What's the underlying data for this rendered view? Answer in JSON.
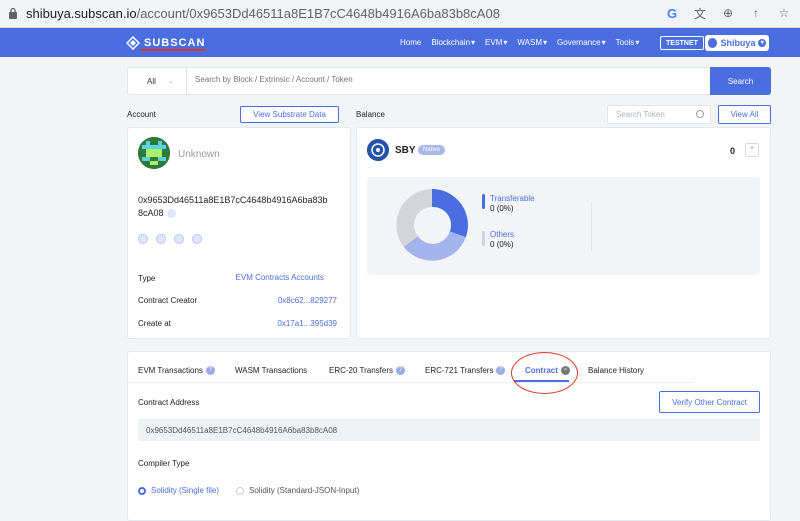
{
  "browser": {
    "url_host": "shibuya.subscan.io",
    "url_path": "/account/0x9653Dd46511a8E1B7cC4648b4916A6ba83b8cA08"
  },
  "nav": {
    "logo": "SUBSCAN",
    "links": [
      "Home",
      "Blockchain",
      "EVM",
      "WASM",
      "Governance",
      "Tools"
    ],
    "testnet": "TESTNET",
    "network": "Shibuya"
  },
  "search": {
    "select": "All",
    "placeholder": "Search by Block / Extrinsic / Account / Token",
    "button": "Search"
  },
  "account": {
    "heading": "Account",
    "view_substrate": "View Substrate Data",
    "name": "Unknown",
    "address": "0x9653Dd46511a8E1B7cC4648b4916A6ba83b8cA08",
    "rows": [
      {
        "key": "Type",
        "value": "EVM Contracts Accounts"
      },
      {
        "key": "Contract Creator",
        "value": "0x8c62...829277"
      },
      {
        "key": "Create at",
        "value": "0x17a1...395d39"
      }
    ]
  },
  "balance": {
    "heading": "Balance",
    "search_token_placeholder": "Search Token",
    "view_all": "View All",
    "token": "SBY",
    "badge": "Native",
    "total": "0",
    "legend": [
      {
        "label": "Transferable",
        "value": "0",
        "pct": "(0%)",
        "color": "#4a6ee0"
      },
      {
        "label": "Others",
        "value": "0",
        "pct": "(0%)",
        "color": "#cfd3dc"
      }
    ],
    "donut_colors": [
      "#4a6ee0",
      "#a3b3ec",
      "#d3d5da"
    ]
  },
  "tabs": {
    "items": [
      "EVM Transactions",
      "WASM Transactions",
      "ERC-20 Transfers",
      "ERC-721 Transfers",
      "Contract",
      "Balance History"
    ],
    "active": "Contract"
  },
  "contract": {
    "address_label": "Contract Address",
    "verify_button": "Verify Other Contract",
    "address": "0x9653Dd46511a8E1B7cC4648b4916A6ba83b8cA08",
    "compiler_label": "Compiler Type",
    "compiler_options": [
      {
        "label": "Solidity (Single file)",
        "selected": true
      },
      {
        "label": "Solidity (Standard-JSON-Input)",
        "selected": false
      }
    ]
  }
}
